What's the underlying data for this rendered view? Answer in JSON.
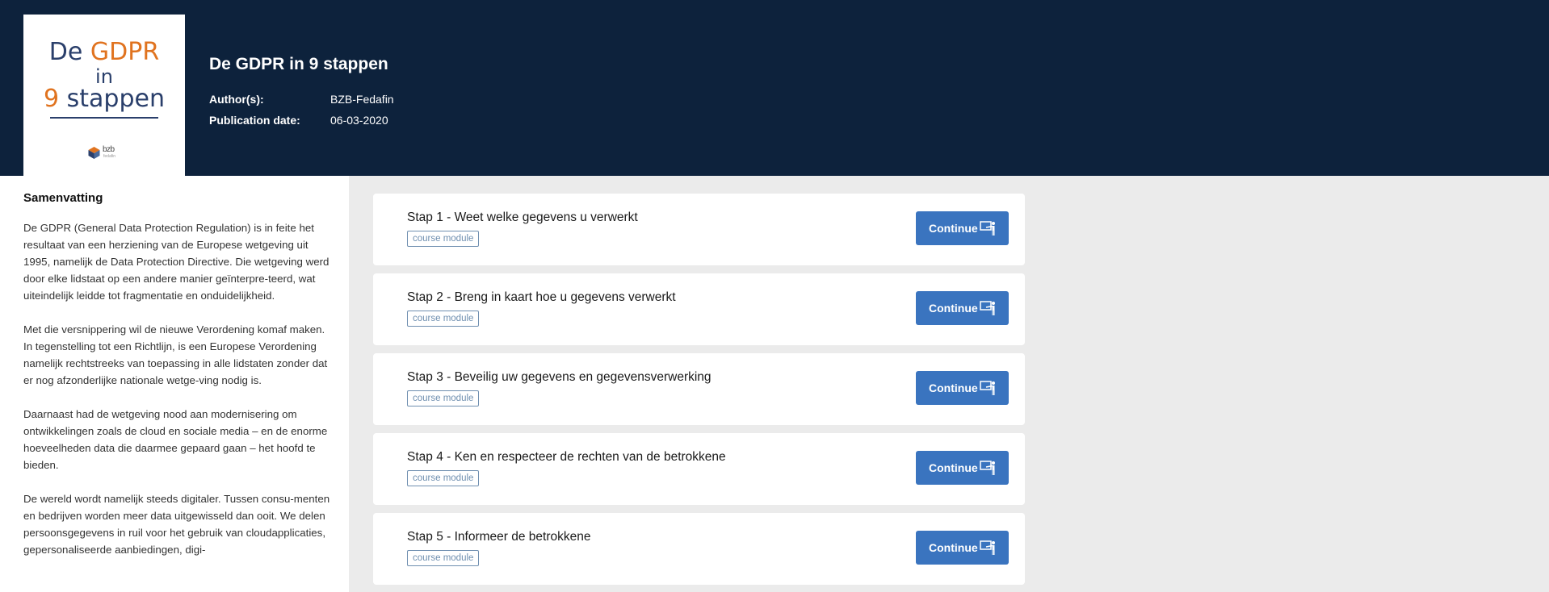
{
  "cover": {
    "line1_a": "De",
    "line1_b": "GDPR",
    "line2": "in",
    "line3_a": "9",
    "line3_b": "stappen",
    "logo_text": "bzb",
    "logo_sub": "fedafin"
  },
  "header": {
    "title": "De GDPR in 9 stappen",
    "author_label": "Author(s):",
    "author_value": "BZB-Fedafin",
    "date_label": "Publication date:",
    "date_value": "06-03-2020"
  },
  "summary": {
    "title": "Samenvatting",
    "paragraphs": [
      "De GDPR (General Data Protection Regulation) is in feite het resultaat van een herziening van de Europese wetgeving uit 1995, namelijk de Data Protection Directive. Die wetgeving werd door elke lidstaat op een andere manier geïnterpre-teerd, wat uiteindelijk leidde tot fragmentatie en onduidelijkheid.",
      "Met die versnippering wil de nieuwe Verordening komaf maken. In tegenstelling tot een Richtlijn, is een Europese Verordening namelijk rechtstreeks van toepassing in alle lidstaten zonder dat er nog afzonderlijke nationale wetge-ving nodig is.",
      "Daarnaast had de wetgeving nood aan modernisering om ontwikkelingen zoals de cloud en sociale media – en de enorme hoeveelheden data die daarmee gepaard gaan – het hoofd te bieden.",
      "De wereld wordt namelijk steeds digitaler. Tussen consu-menten en bedrijven worden meer data uitgewisseld dan ooit. We delen persoonsgegevens in ruil voor het gebruik van cloudapplicaties, gepersonaliseerde aanbiedingen, digi-"
    ]
  },
  "modules": [
    {
      "title": "Stap 1 - Weet welke gegevens u verwerkt",
      "tag": "course module",
      "button": "Continue"
    },
    {
      "title": "Stap 2 - Breng in kaart hoe u gegevens verwerkt",
      "tag": "course module",
      "button": "Continue"
    },
    {
      "title": "Stap 3 - Beveilig uw gegevens en gegevensverwerking",
      "tag": "course module",
      "button": "Continue"
    },
    {
      "title": "Stap 4 - Ken en respecteer de rechten van de betrokkene",
      "tag": "course module",
      "button": "Continue"
    },
    {
      "title": "Stap 5 - Informeer de betrokkene",
      "tag": "course module",
      "button": "Continue"
    }
  ],
  "colors": {
    "header_bg": "#0d223c",
    "accent": "#e0731f",
    "button": "#3a74bf",
    "tag": "#6f8fb0"
  },
  "icons": {
    "continue": "presentation-board-icon",
    "logo": "bzb-logo-icon"
  }
}
